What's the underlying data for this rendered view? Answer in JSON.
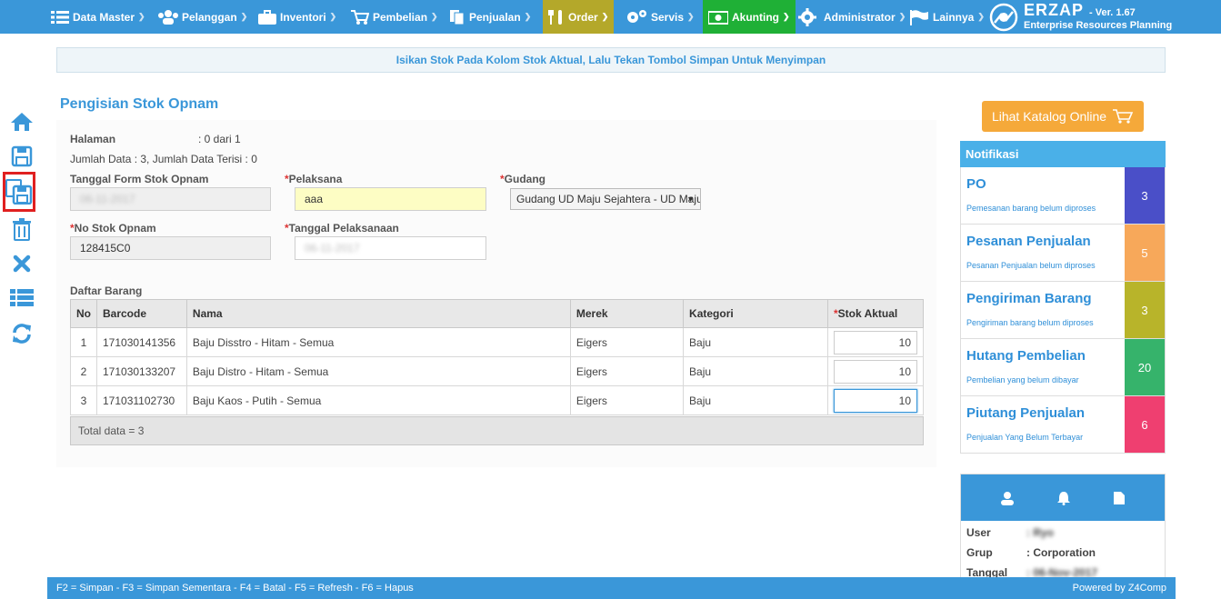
{
  "nav": {
    "items": [
      {
        "label": "Data Master"
      },
      {
        "label": "Pelanggan"
      },
      {
        "label": "Inventori"
      },
      {
        "label": "Pembelian"
      },
      {
        "label": "Penjualan"
      },
      {
        "label": "Order"
      },
      {
        "label": "Servis"
      },
      {
        "label": "Akunting"
      },
      {
        "label": "Administrator"
      },
      {
        "label": "Lainnya"
      }
    ],
    "logo_name": "ERZAP",
    "logo_version": "- Ver. 1.67",
    "logo_subtitle": "Enterprise Resources Planning"
  },
  "banner": "Isikan Stok Pada Kolom Stok Aktual, Lalu Tekan Tombol Simpan Untuk Menyimpan",
  "page_title": "Pengisian Stok Opnam",
  "form": {
    "halaman_label": "Halaman",
    "halaman_value": ": 0 dari 1",
    "jumlah_data": "Jumlah Data : 3, Jumlah Data Terisi : 0",
    "tanggal_form_label": "Tanggal Form Stok Opnam",
    "tanggal_form_value": "06-11-2017",
    "pelaksana_label": "Pelaksana",
    "pelaksana_value": "aaa",
    "gudang_label": "Gudang",
    "gudang_value": "Gudang UD Maju Sejahtera - UD Maju Sejahtera",
    "no_stok_label": "No Stok Opnam",
    "no_stok_value": "128415C0",
    "tanggal_pelaksanaan_label": "Tanggal Pelaksanaan",
    "tanggal_pelaksanaan_value": "06-11-2017",
    "required_mark": "*"
  },
  "table": {
    "caption": "Daftar Barang",
    "headers": [
      "No",
      "Barcode",
      "Nama",
      "Merek",
      "Kategori",
      "Stok Aktual"
    ],
    "rows": [
      {
        "no": "1",
        "barcode": "171030141356",
        "nama": "Baju Disstro - Hitam - Semua",
        "merek": "Eigers",
        "kategori": "Baju",
        "stok": "10"
      },
      {
        "no": "2",
        "barcode": "171030133207",
        "nama": "Baju Distro - Hitam - Semua",
        "merek": "Eigers",
        "kategori": "Baju",
        "stok": "10"
      },
      {
        "no": "3",
        "barcode": "171031102730",
        "nama": "Baju Kaos - Putih - Semua",
        "merek": "Eigers",
        "kategori": "Baju",
        "stok": "10"
      }
    ],
    "footer": "Total data =  3"
  },
  "katalog_button": "Lihat Katalog Online",
  "notifikasi": {
    "title": "Notifikasi",
    "items": [
      {
        "title": "PO",
        "subtitle": "Pemesanan barang belum diproses",
        "count": "3",
        "color": "#4a4fc8"
      },
      {
        "title": "Pesanan Penjualan",
        "subtitle": "Pesanan Penjualan belum diproses",
        "count": "5",
        "color": "#f7a85a"
      },
      {
        "title": "Pengiriman Barang",
        "subtitle": "Pengiriman barang belum diproses",
        "count": "3",
        "color": "#b8b42a"
      },
      {
        "title": "Hutang Pembelian",
        "subtitle": "Pembelian yang belum dibayar",
        "count": "20",
        "color": "#36b36b"
      },
      {
        "title": "Piutang Penjualan",
        "subtitle": "Penjualan Yang Belum Terbayar",
        "count": "6",
        "color": "#ef3f70"
      }
    ]
  },
  "user": {
    "user_label": "User",
    "user_value": ": Ryo",
    "grup_label": "Grup",
    "grup_value": ": Corporation",
    "tanggal_label": "Tanggal",
    "tanggal_value": ": 06-Nov-2017"
  },
  "bottom": {
    "shortcuts": "F2 = Simpan - F3 = Simpan Sementara - F4 = Batal - F5 = Refresh - F6 = Hapus",
    "powered": "Powered by Z4Comp"
  },
  "colors": {
    "primary": "#3a97d9",
    "order_active": "#b4a82a",
    "akunting_active": "#1fb036",
    "katalog": "#f5a93a"
  },
  "icons": [
    "home-icon",
    "save-icon",
    "save-draft-icon",
    "trash-icon",
    "close-icon",
    "list-icon",
    "refresh-icon"
  ]
}
